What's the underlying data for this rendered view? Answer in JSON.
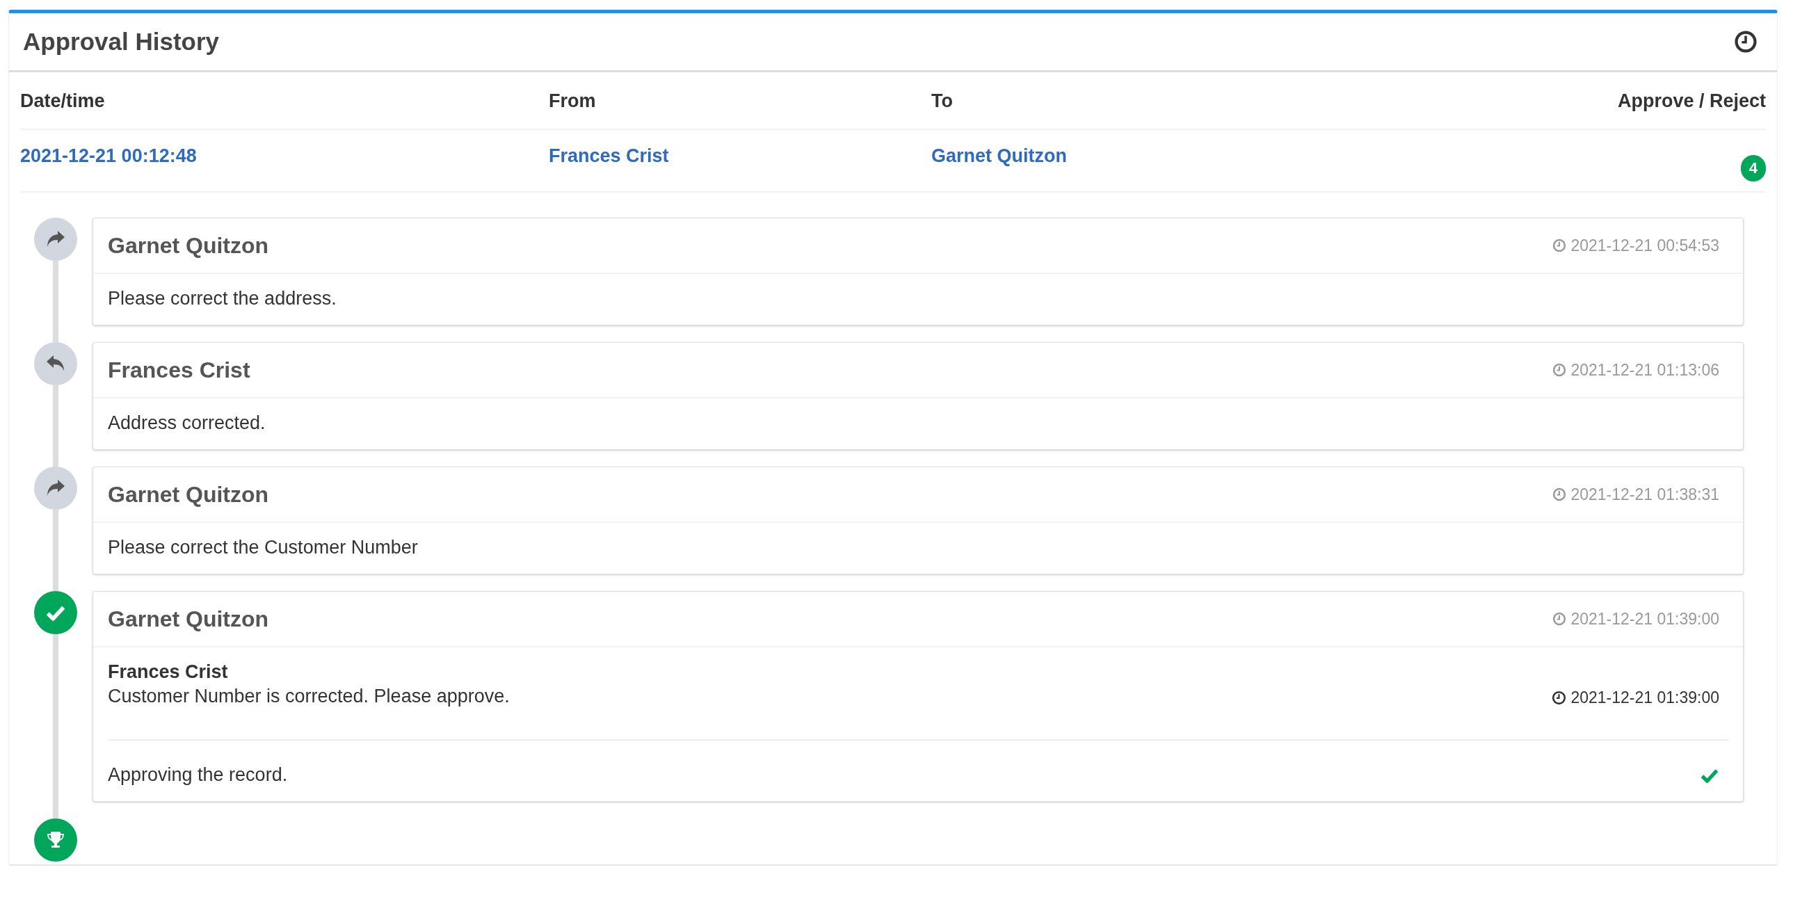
{
  "panel": {
    "title": "Approval History"
  },
  "table": {
    "columns": [
      "Date/time",
      "From",
      "To",
      "Approve / Reject"
    ],
    "rows": [
      {
        "datetime": "2021-12-21 00:12:48",
        "from": "Frances Crist",
        "to": "Garnet Quitzon",
        "count": "4"
      }
    ]
  },
  "timeline": {
    "completed": true,
    "events": [
      {
        "kind": "forward",
        "author": "Garnet Quitzon",
        "time": "2021-12-21 00:54:53",
        "message": "Please correct the address."
      },
      {
        "kind": "reply",
        "author": "Frances Crist",
        "time": "2021-12-21 01:13:06",
        "message": "Address corrected."
      },
      {
        "kind": "forward",
        "author": "Garnet Quitzon",
        "time": "2021-12-21 01:38:31",
        "message": "Please correct the Customer Number"
      },
      {
        "kind": "approve",
        "author": "Garnet Quitzon",
        "time": "2021-12-21 01:39:00",
        "quote": {
          "author": "Frances Crist",
          "message": "Customer Number is corrected. Please approve.",
          "time": "2021-12-21 01:39:00"
        },
        "decision": {
          "text": "Approving the record.",
          "approved": true
        }
      }
    ]
  }
}
